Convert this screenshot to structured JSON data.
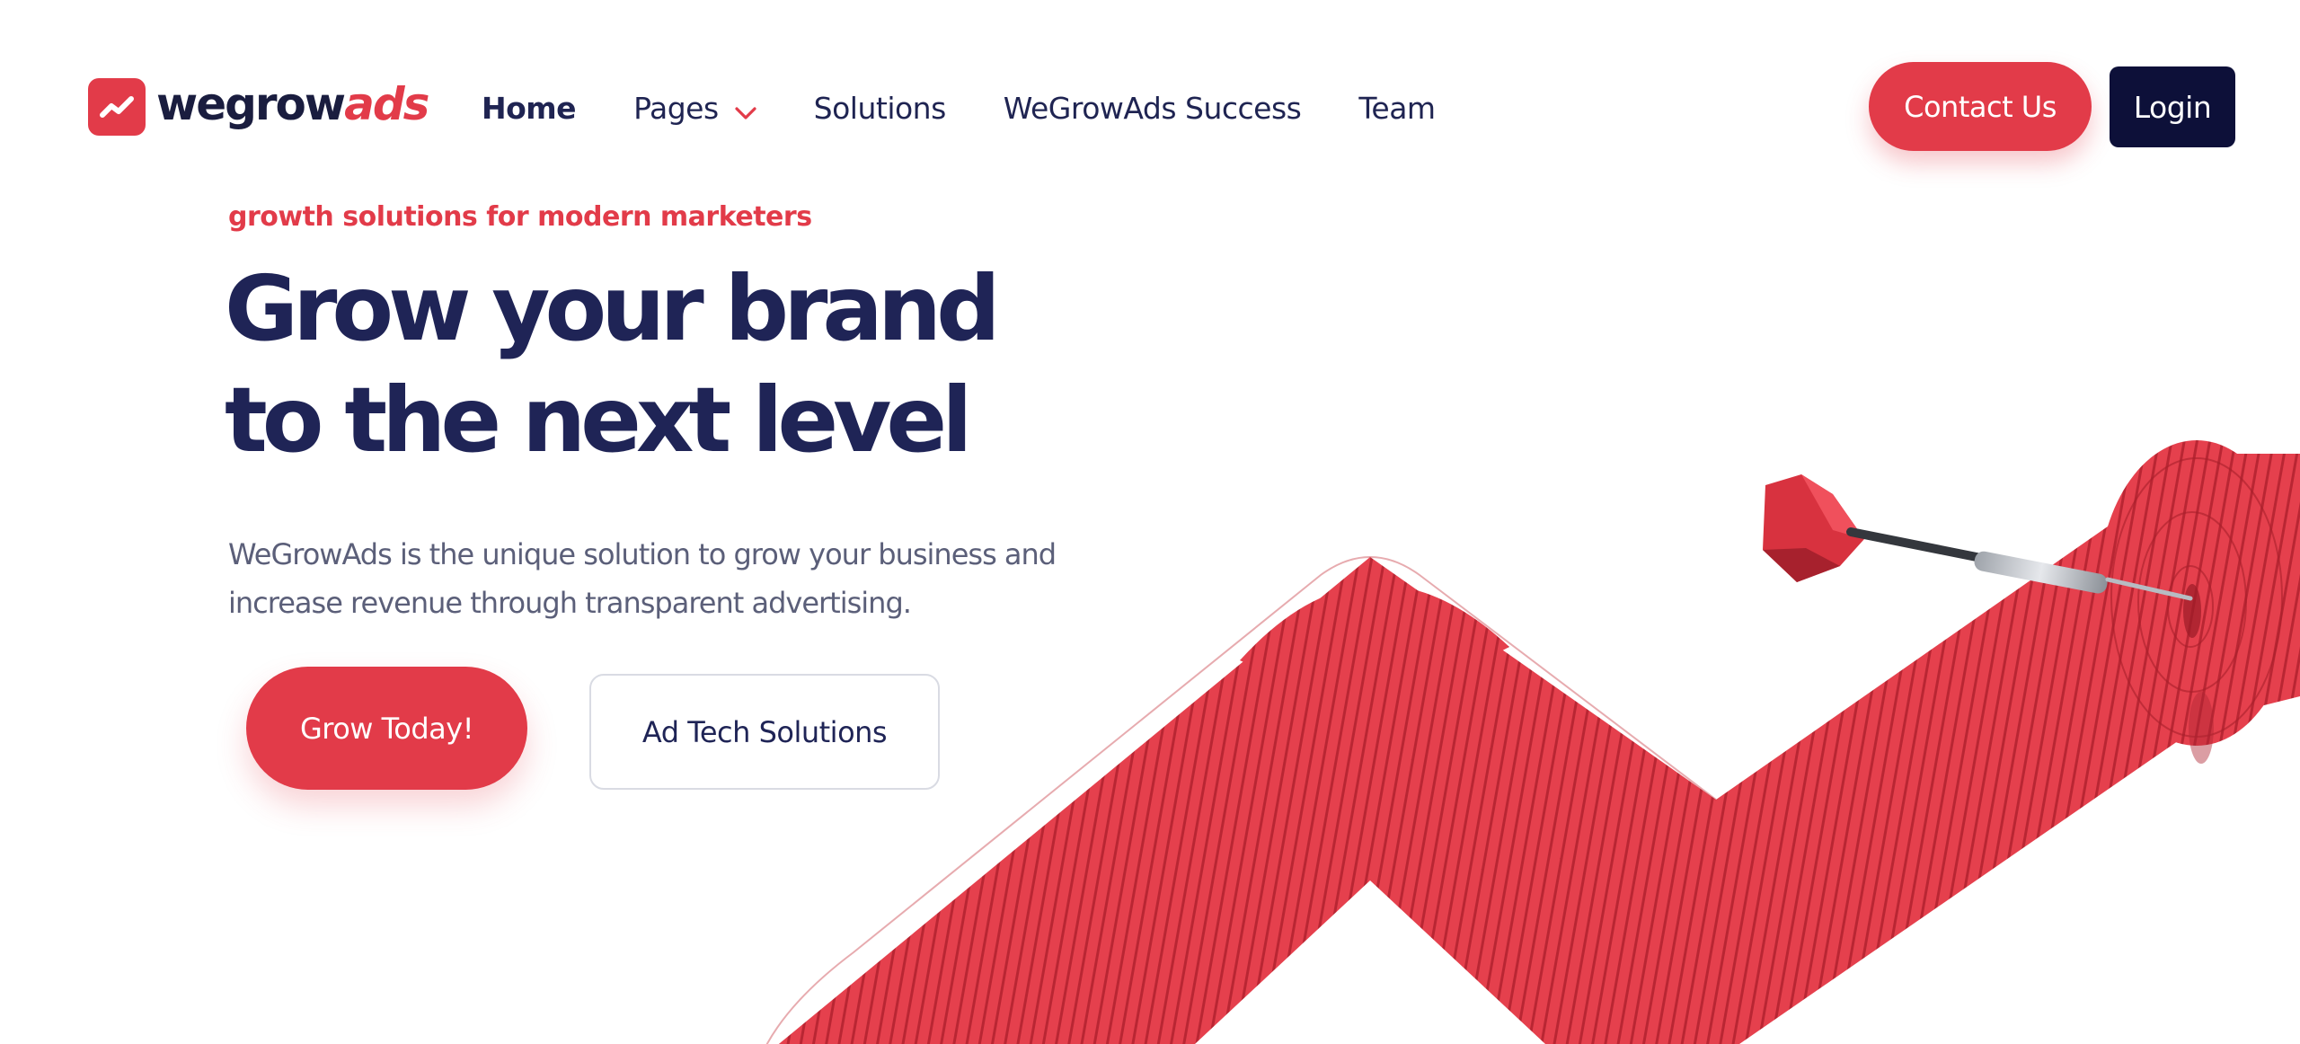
{
  "brand": {
    "name_part1": "wegrow",
    "name_part2": "ads",
    "logo_icon": "trending-up-icon",
    "colors": {
      "accent": "#e23b49",
      "navy": "#1f2456",
      "dark_button": "#0d1039",
      "muted_text": "#5b5f79"
    }
  },
  "nav": {
    "items": [
      {
        "label": "Home",
        "active": true
      },
      {
        "label": "Pages",
        "has_dropdown": true,
        "dropdown_icon": "chevron-down-icon"
      },
      {
        "label": "Solutions"
      },
      {
        "label": "WeGrowAds Success"
      },
      {
        "label": "Team"
      }
    ],
    "contact_label": "Contact Us",
    "login_label": "Login"
  },
  "hero": {
    "eyebrow": "growth solutions for modern marketers",
    "title_line1": "Grow your brand",
    "title_line2": "to the next level",
    "description_line1": "WeGrowAds is the unique solution to grow your business and",
    "description_line2": "increase revenue through transparent advertising.",
    "primary_cta": "Grow Today!",
    "secondary_cta": "Ad Tech Solutions",
    "illustration": "growth-arrow-with-dart"
  }
}
